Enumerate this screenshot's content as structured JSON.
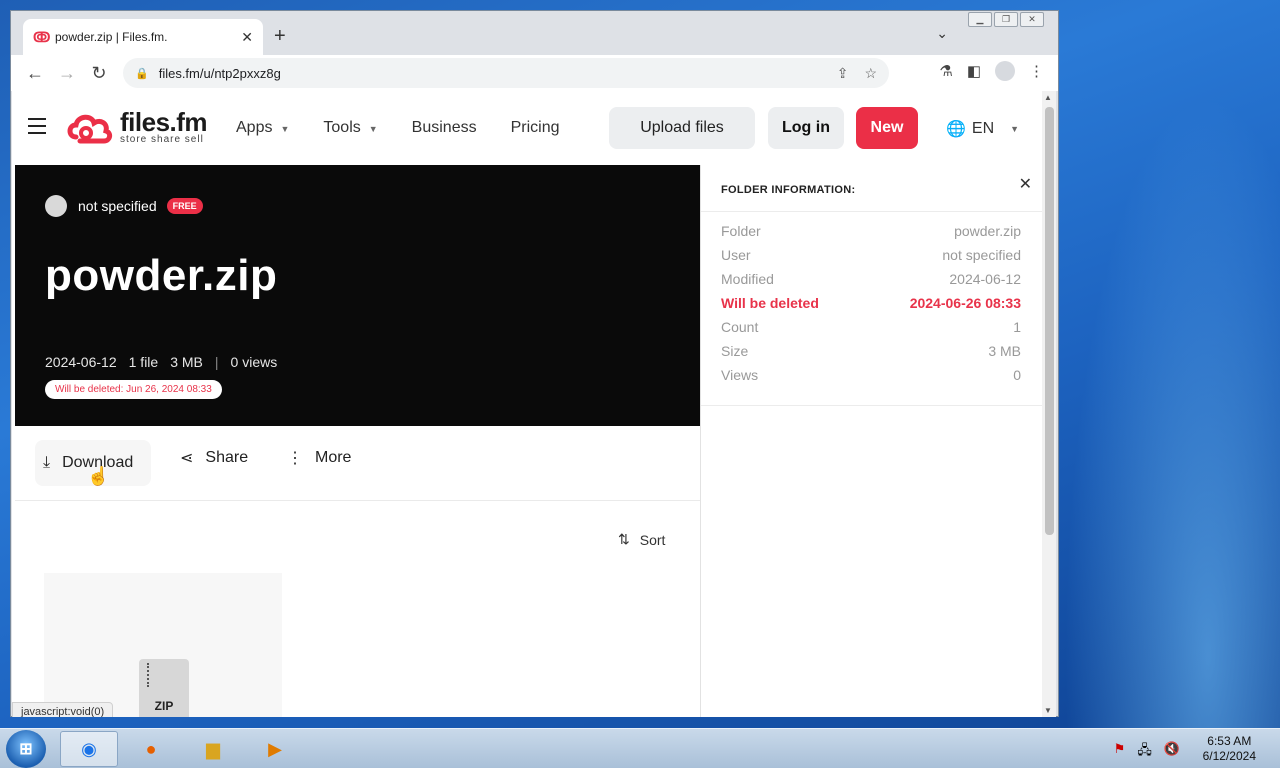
{
  "browser": {
    "tab_title": "powder.zip | Files.fm.",
    "tab_close": "✕",
    "new_tab": "+",
    "url": "files.fm/u/ntp2pxxz8g",
    "status_url": "javascript:void(0)"
  },
  "site": {
    "logo_name": "files.fm",
    "logo_tagline": "store share sell",
    "nav": [
      {
        "label": "Apps",
        "has_caret": true
      },
      {
        "label": "Tools",
        "has_caret": true
      },
      {
        "label": "Business",
        "has_caret": false
      },
      {
        "label": "Pricing",
        "has_caret": false
      }
    ],
    "upload_label": "Upload files",
    "login_label": "Log in",
    "new_label": "New",
    "lang_label": "EN",
    "brand_color": "#eb2f47"
  },
  "hero": {
    "owner": "not specified",
    "badge": "FREE",
    "title": "powder.zip",
    "date": "2024-06-12",
    "file_count": "1 file",
    "size": "3 MB",
    "views": "0 views",
    "delete_notice": "Will be deleted: Jun 26, 2024 08:33"
  },
  "actions": {
    "download": "Download",
    "share": "Share",
    "more": "More",
    "sort": "Sort"
  },
  "file": {
    "type_label": "ZIP"
  },
  "info": {
    "header": "FOLDER INFORMATION:",
    "rows": [
      {
        "label": "Folder",
        "value": "powder.zip"
      },
      {
        "label": "User",
        "value": "not specified"
      },
      {
        "label": "Modified",
        "value": "2024-06-12"
      },
      {
        "label": "Will be deleted",
        "value": "2024-06-26 08:33"
      },
      {
        "label": "Count",
        "value": "1"
      },
      {
        "label": "Size",
        "value": "3 MB"
      },
      {
        "label": "Views",
        "value": "0"
      }
    ]
  },
  "taskbar": {
    "time": "6:53 AM",
    "date": "6/12/2024"
  }
}
